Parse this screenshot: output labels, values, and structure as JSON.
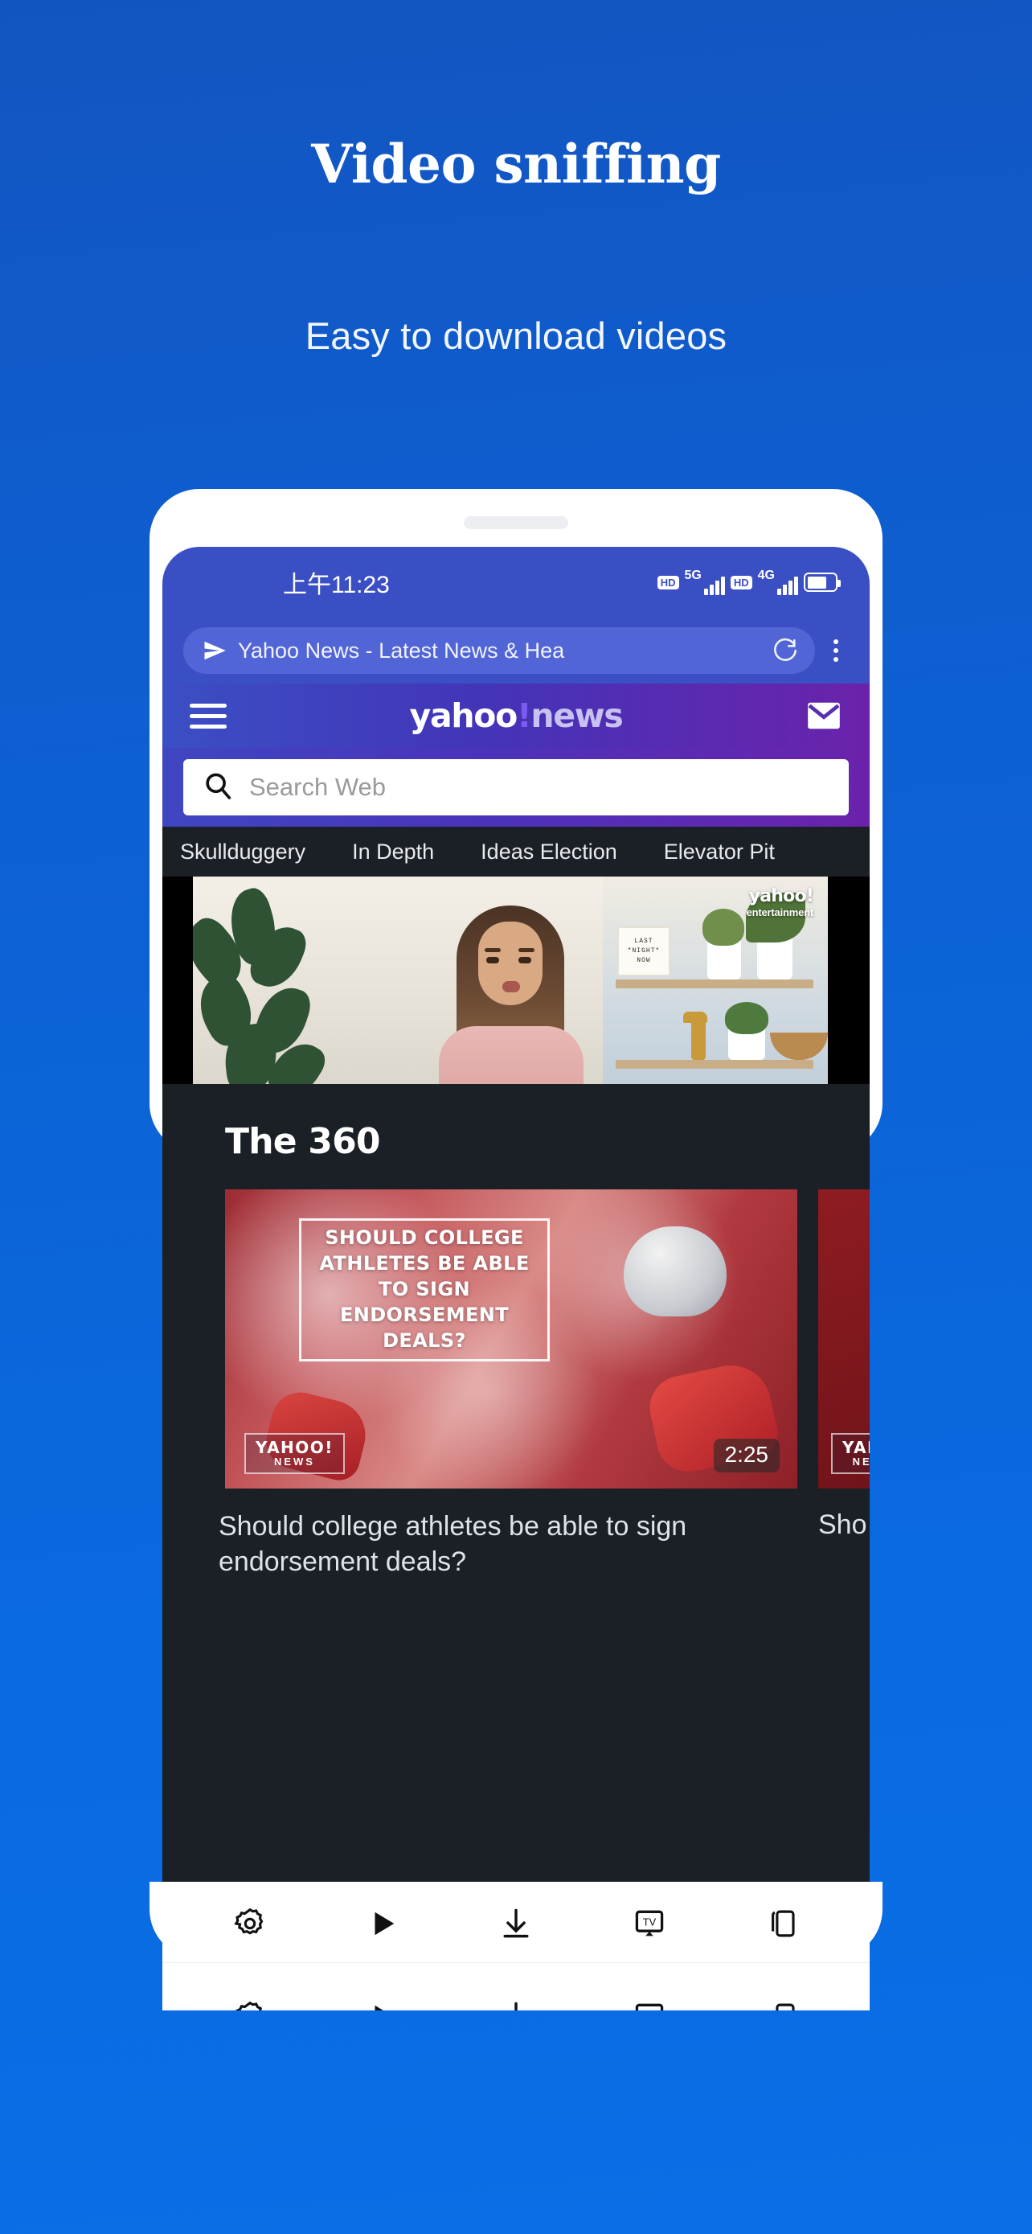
{
  "promo": {
    "title": "Video sniffing",
    "subtitle": "Easy to download videos",
    "background_color": "#0c63d6"
  },
  "phone": {
    "statusbar": {
      "time": "上午11:23",
      "hd_badge_1": "HD",
      "network_1": "5G",
      "hd_badge_2": "HD",
      "network_2": "4G"
    },
    "browser": {
      "url_title": "Yahoo News - Latest News & Hea",
      "send_icon": "send-icon",
      "reload_icon": "reload-icon",
      "menu_icon": "kebab-menu-icon"
    },
    "site_header": {
      "menu_icon": "hamburger-icon",
      "logo_part1": "yahoo",
      "logo_bang": "!",
      "logo_part2": "news",
      "mail_icon": "mail-icon"
    },
    "search": {
      "placeholder": "Search Web",
      "icon": "search-icon"
    },
    "nav_tabs": [
      {
        "label": "Skullduggery"
      },
      {
        "label": "In Depth"
      },
      {
        "label": "Ideas Election"
      },
      {
        "label": "Elevator Pit"
      }
    ],
    "hero_video": {
      "watermark_line1": "yahoo!",
      "watermark_line2": "entertainment",
      "sign_line1": "LAST",
      "sign_line2": "*NIGHT*",
      "sign_line3": "NOW"
    },
    "section_360": {
      "title": "The 360",
      "cards": [
        {
          "overlay_text": "SHOULD COLLEGE ATHLETES BE ABLE TO SIGN ENDORSEMENT DEALS?",
          "logo_line1": "YAHOO!",
          "logo_line2": "NEWS",
          "duration": "2:25",
          "caption": "Should college athletes be able to sign endorsement deals?"
        },
        {
          "logo_line1": "YAH",
          "logo_line2": "NE",
          "caption": "Sho"
        }
      ]
    },
    "toolbar": [
      {
        "icon": "settings-gear-icon",
        "name": "settings-button"
      },
      {
        "icon": "play-icon",
        "name": "play-button"
      },
      {
        "icon": "download-icon",
        "name": "download-button"
      },
      {
        "icon": "cast-tv-icon",
        "name": "cast-button"
      },
      {
        "icon": "tabs-copy-icon",
        "name": "tabs-button"
      }
    ],
    "colors": {
      "statusbar": "#3b4fc4",
      "header_gradient_start": "#3b4fc4",
      "header_gradient_end": "#6b22ab",
      "content_dark": "#1b1f26"
    }
  }
}
